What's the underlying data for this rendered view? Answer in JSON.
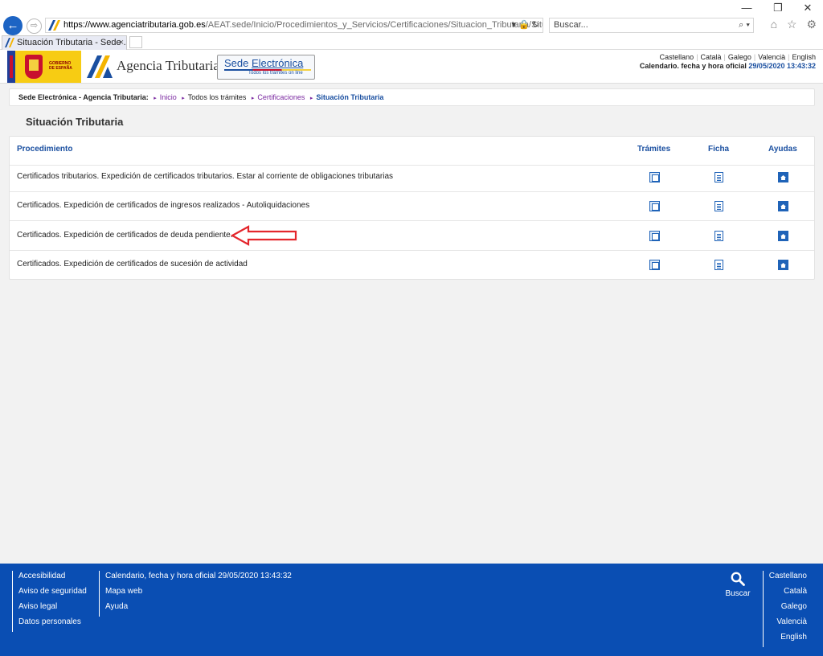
{
  "browser": {
    "url_host": "https://www.agenciatributaria.gob.es",
    "url_rest": "/AEAT.sede/Inicio/Procedimientos_y_Servicios/Certificaciones/Situacion_Tributaria/Situacion_",
    "url_tools": "▾ 🔒 ↻",
    "search_placeholder": "Buscar...",
    "search_glyph": "⌕ ▾",
    "tab_title": "Situación Tributaria - Sede ...",
    "tab_close": "×",
    "minimize": "—",
    "restore": "❐",
    "close": "✕",
    "back": "←",
    "forward": "⇨",
    "right_icons": "⌂ ☆ ⚙"
  },
  "header": {
    "gov_text_1": "GOBIERNO",
    "gov_text_2": "DE ESPAÑA",
    "agency_name": "Agencia Tributaria",
    "sede_title_1": "Sede ",
    "sede_title_2": "Electrónica",
    "sede_subtitle": "Todos los trámites on line",
    "languages": [
      "Castellano",
      "Català",
      "Galego",
      "Valencià",
      "English"
    ],
    "calendar_label": "Calendario. fecha y hora oficial",
    "calendar_value": "29/05/2020 13:43:32"
  },
  "breadcrumb": {
    "root": "Sede Electrónica - Agencia Tributaria:",
    "items": [
      "Inicio",
      "Todos los trámites",
      "Certificaciones",
      "Situación Tributaria"
    ],
    "arrow": "▸"
  },
  "page_title": "Situación Tributaria",
  "table": {
    "headers": {
      "procedimiento": "Procedimiento",
      "tramites": "Trámites",
      "ficha": "Ficha",
      "ayudas": "Ayudas"
    },
    "rows": [
      "Certificados tributarios. Expedición de certificados tributarios. Estar al corriente de obligaciones tributarias",
      "Certificados. Expedición de certificados de ingresos realizados - Autoliquidaciones",
      "Certificados. Expedición de certificados de deuda pendiente.",
      "Certificados. Expedición de certificados de sucesión de actividad"
    ]
  },
  "footer": {
    "col1": [
      "Accesibilidad",
      "Aviso de seguridad",
      "Aviso legal",
      "Datos personales"
    ],
    "col2": [
      "Calendario, fecha y hora oficial 29/05/2020 13:43:32",
      "Mapa web",
      "Ayuda"
    ],
    "search_label": "Buscar",
    "languages": [
      "Castellano",
      "Català",
      "Galego",
      "Valencià",
      "English"
    ]
  },
  "colors": {
    "brand_blue": "#0a4eb3",
    "link_purple": "#7a28a0",
    "annotation_red": "#e4262c"
  }
}
